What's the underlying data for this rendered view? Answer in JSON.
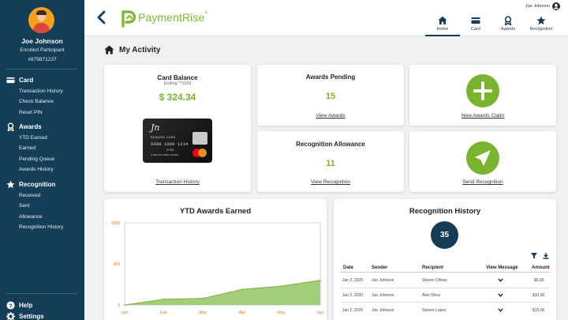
{
  "user": {
    "name": "Joe Johnson",
    "status": "Enrolled Participant",
    "id": "#879871237"
  },
  "sidebar": {
    "sections": [
      {
        "title": "Card",
        "icon": "card-icon",
        "items": [
          "Transaction History",
          "Check Balance",
          "Reset PIN"
        ]
      },
      {
        "title": "Awards",
        "icon": "award-icon",
        "items": [
          "YTD Earned",
          "Earned",
          "Pending Queue",
          "Awards History"
        ]
      },
      {
        "title": "Recognition",
        "icon": "star-icon",
        "items": [
          "Received",
          "Sent",
          "Allowance",
          "Recognition History"
        ]
      }
    ],
    "footer": {
      "help": "Help",
      "settings": "Settings"
    }
  },
  "topbar": {
    "brand": "PaymentRise",
    "brand_mark": "®",
    "user_name": "Joe Johnson",
    "nav": [
      {
        "label": "Home",
        "icon": "home-icon",
        "active": true
      },
      {
        "label": "Card",
        "icon": "card-icon",
        "active": false
      },
      {
        "label": "Awards",
        "icon": "award-icon",
        "active": false
      },
      {
        "label": "Recognition",
        "icon": "star-icon",
        "active": false
      }
    ]
  },
  "page": {
    "title": "My Activity"
  },
  "card_balance": {
    "title": "Card Balance",
    "ending": "Ending **1169",
    "amount": "$ 324.34",
    "link": "Transaction History",
    "card_image": {
      "signature": "Jn",
      "label": "REWARD CARD",
      "number": "5498 1000 1234",
      "expiry": "07/25",
      "holder": "CARDHOLDER NAME"
    }
  },
  "awards_pending": {
    "title": "Awards Pending",
    "value": "15",
    "link": "View Awards"
  },
  "new_claim": {
    "link": "New Awards Claim",
    "icon": "plus-icon"
  },
  "recognition_allowance": {
    "title": "Recognition Allowance",
    "value": "11",
    "link": "View Recognition"
  },
  "send_recognition": {
    "link": "Send Recognition",
    "icon": "paper-plane-icon"
  },
  "ytd_chart": {
    "heading": "YTD Awards Earned"
  },
  "chart_data": {
    "type": "area",
    "title": "YTD Awards Earned",
    "categories": [
      "Jan",
      "Feb",
      "Mar",
      "Apr",
      "May",
      "Jun"
    ],
    "values": [
      0,
      70,
      80,
      190,
      230,
      300
    ],
    "ylim": [
      0,
      1000
    ],
    "yticks": [
      "0",
      "500",
      "1000"
    ],
    "grid": false,
    "fill_color": "#a3cd7a",
    "line_color": "#7ab32f"
  },
  "recognition_history": {
    "title": "Recognition History",
    "count": "35",
    "columns": [
      "Date",
      "Sender",
      "Recipient",
      "View Message",
      "Amount"
    ],
    "rows": [
      {
        "date": "Jan 2, 2020",
        "sender": "Joe Johnson",
        "recipient": "Steven Chhan",
        "amount": "$5.00"
      },
      {
        "date": "Jan 2, 2020",
        "sender": "Joe Johnson",
        "recipient": "Alex Shea",
        "amount": "$10.00"
      },
      {
        "date": "Jan 2, 2020",
        "sender": "Joe Johnson",
        "recipient": "Steven Lopez",
        "amount": "$15.00"
      }
    ]
  },
  "colors": {
    "sidebar": "#143d57",
    "brand_green": "#7ab32f",
    "badge": "#173d56"
  }
}
